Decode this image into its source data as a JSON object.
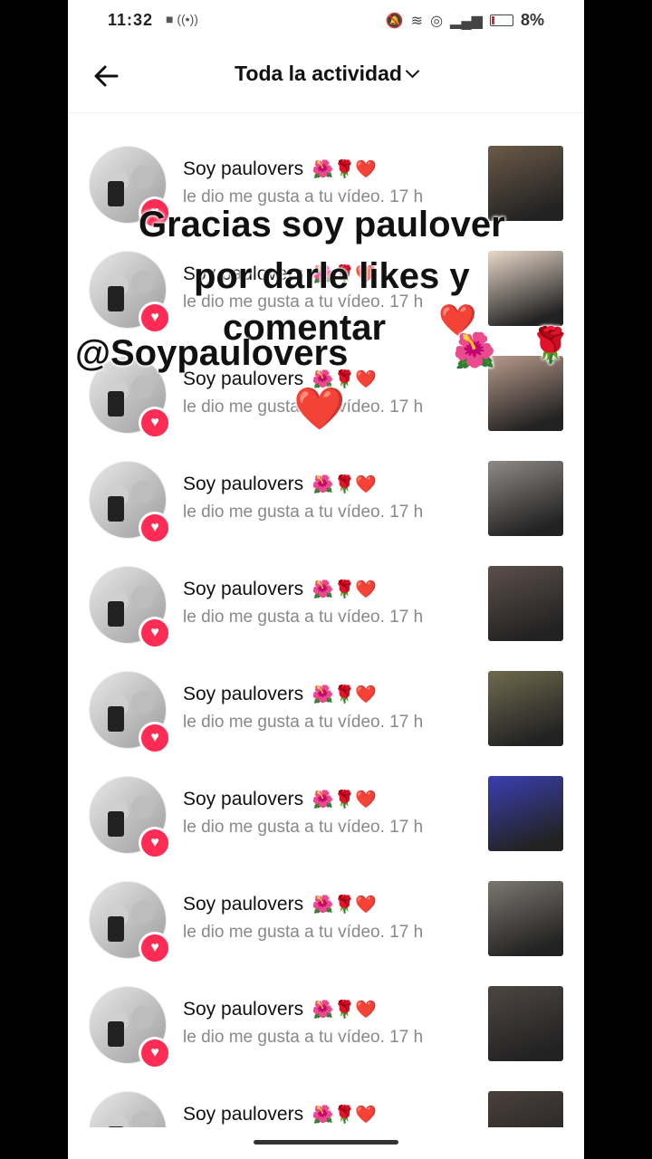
{
  "status": {
    "time": "11:32",
    "battery_pct": "8%"
  },
  "header": {
    "title": "Toda la actividad"
  },
  "rows": [
    {
      "name": "Soy paulovers",
      "emojis": "🌺🌹❤️",
      "text": "le dio me gusta a tu vídeo.",
      "time": "17 h",
      "thumb_color": "#6b5a48"
    },
    {
      "name": "Soy paulovers",
      "emojis": "🌺🌹❤️",
      "text": "le dio me gusta a tu vídeo.",
      "time": "17 h",
      "thumb_color": "#e9d9c9"
    },
    {
      "name": "Soy paulovers",
      "emojis": "🌺🌹❤️",
      "text": "le dio me gusta a tu vídeo.",
      "time": "17 h",
      "thumb_color": "#b89a8a"
    },
    {
      "name": "Soy paulovers",
      "emojis": "🌺🌹❤️",
      "text": "le dio me gusta a tu vídeo.",
      "time": "17 h",
      "thumb_color": "#8f8a86"
    },
    {
      "name": "Soy paulovers",
      "emojis": "🌺🌹❤️",
      "text": "le dio me gusta a tu vídeo.",
      "time": "17 h",
      "thumb_color": "#5c4f4a"
    },
    {
      "name": "Soy paulovers",
      "emojis": "🌺🌹❤️",
      "text": "le dio me gusta a tu vídeo.",
      "time": "17 h",
      "thumb_color": "#6f6a4e"
    },
    {
      "name": "Soy paulovers",
      "emojis": "🌺🌹❤️",
      "text": "le dio me gusta a tu vídeo.",
      "time": "17 h",
      "thumb_color": "#3a3fb0"
    },
    {
      "name": "Soy paulovers",
      "emojis": "🌺🌹❤️",
      "text": "le dio me gusta a tu vídeo.",
      "time": "17 h",
      "thumb_color": "#7b7770"
    },
    {
      "name": "Soy paulovers",
      "emojis": "🌺🌹❤️",
      "text": "le dio me gusta a tu vídeo.",
      "time": "17 h",
      "thumb_color": "#4e4642"
    },
    {
      "name": "Soy paulovers",
      "emojis": "🌺🌹❤️",
      "text": "",
      "time": "",
      "thumb_color": "#4a403c"
    }
  ],
  "overlay": {
    "line1": "Gracias soy paulover",
    "line2": "por darle likes y",
    "line3": "comentar",
    "line4": "@Soypaulovers",
    "heart": "❤️",
    "hibiscus": "🌺",
    "rose": "🌹"
  }
}
